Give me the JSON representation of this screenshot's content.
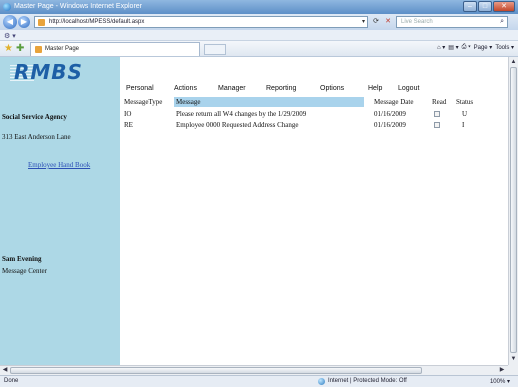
{
  "window": {
    "title": "Master Page - Windows Internet Explorer",
    "buttons": {
      "minimize": "–",
      "maximize": "□",
      "close": "✕"
    }
  },
  "address": {
    "url": "http://localhost/MPESS/default.aspx",
    "search_placeholder": "Live Search"
  },
  "browser": {
    "tab_title": "Master Page",
    "commands": [
      "Page ▾",
      "Tools ▾"
    ]
  },
  "sidebar": {
    "logo": "RMBS",
    "agency": "Social Service Agency",
    "address": "313 East Anderson Lane",
    "handbook_link": "Employee Hand Book",
    "user_name": "Sam Evening",
    "section": "Message Center"
  },
  "menu": {
    "items": [
      "Personal",
      "Actions",
      "Manager",
      "Reporting",
      "Options",
      "Help",
      "Logout"
    ]
  },
  "table": {
    "headers": [
      "MessageType",
      "Message",
      "Message Date",
      "Read",
      "Status"
    ],
    "rows": [
      {
        "type": "IO",
        "message": "Please return all W4 changes by the 1/29/2009",
        "date": "01/16/2009",
        "read": false,
        "status": "U"
      },
      {
        "type": "RE",
        "message": "Employee 0000 Requested Address Change",
        "date": "01/16/2009",
        "read": false,
        "status": "I"
      }
    ]
  },
  "status": {
    "text": "Done",
    "zone": "Internet | Protected Mode: Off",
    "zoom": "100% ▾"
  },
  "colors": {
    "sidebar": "#add8e6",
    "header_shade": "#a9d3ec",
    "link": "#2b4fb5",
    "logo": "#1e5fa6"
  }
}
